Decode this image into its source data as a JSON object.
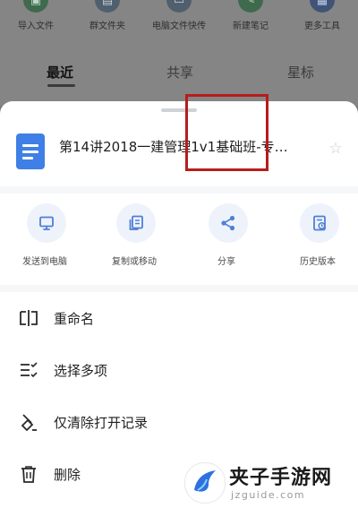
{
  "quick_actions": [
    {
      "label": "导入文件",
      "icon": "import-icon"
    },
    {
      "label": "群文件夹",
      "icon": "group-folder-icon"
    },
    {
      "label": "电脑文件快传",
      "icon": "computer-transfer-icon"
    },
    {
      "label": "新建笔记",
      "icon": "new-note-icon"
    },
    {
      "label": "更多工具",
      "icon": "more-tools-icon"
    }
  ],
  "tabs": [
    "最近",
    "共享",
    "星标"
  ],
  "sheet": {
    "file_title": "第14讲2018一建管理1v1基础班-专…",
    "share_actions": [
      {
        "label": "发送到电脑",
        "icon": "computer-icon"
      },
      {
        "label": "复制或移动",
        "icon": "copy-icon"
      },
      {
        "label": "分享",
        "icon": "share-icon"
      },
      {
        "label": "历史版本",
        "icon": "history-icon"
      }
    ],
    "menu": [
      {
        "label": "重命名",
        "icon": "rename-icon"
      },
      {
        "label": "选择多项",
        "icon": "multi-select-icon"
      },
      {
        "label": "仅清除打开记录",
        "icon": "clear-record-icon"
      },
      {
        "label": "删除",
        "icon": "trash-icon"
      }
    ]
  },
  "watermark": {
    "title": "夹子手游网",
    "subtitle": "jzguide.com"
  },
  "colors": {
    "accent": "#3f7fe6",
    "highlight": "#b71c1c",
    "icon_tint": "#4f7fd6"
  }
}
